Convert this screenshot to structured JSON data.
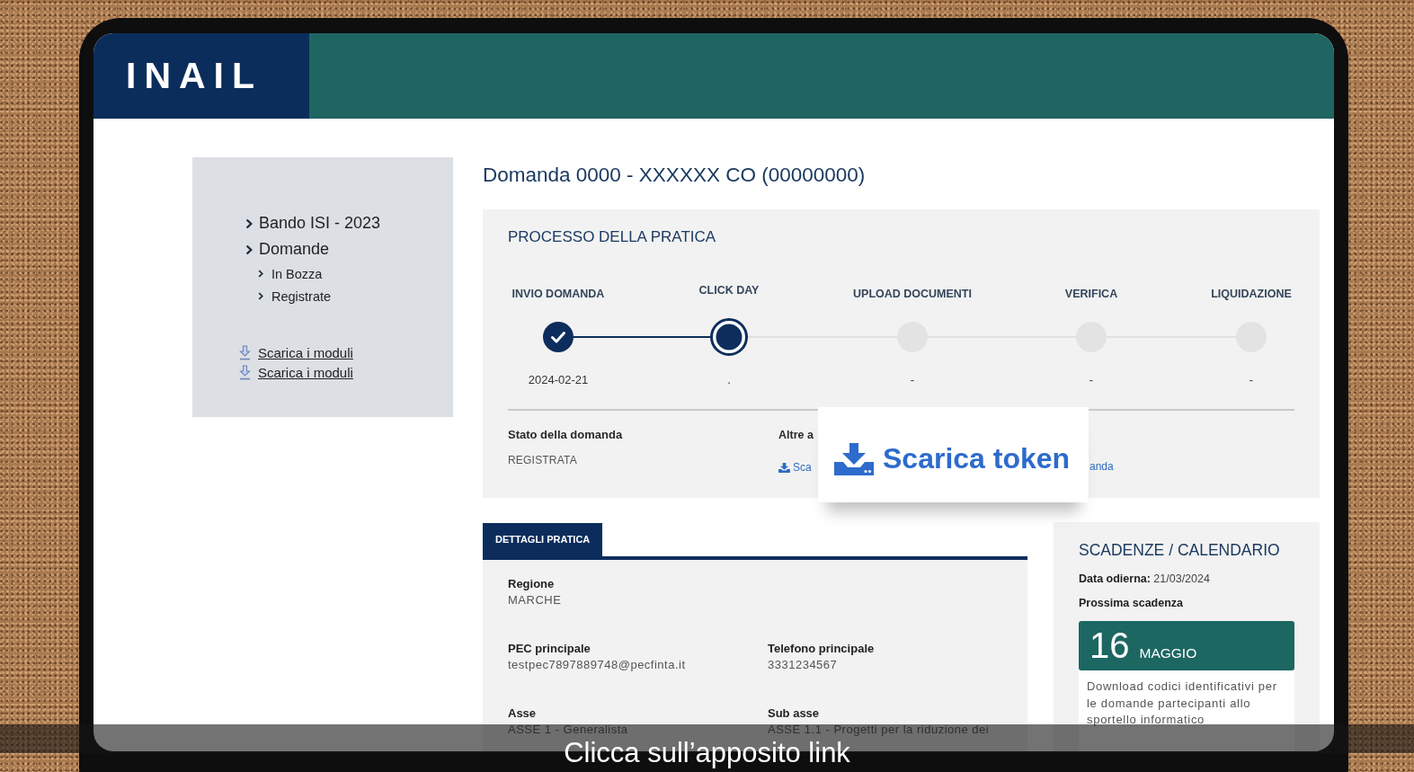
{
  "header": {
    "logo": "INAIL"
  },
  "sidebar": {
    "items": [
      {
        "label": "Bando ISI - 2023"
      },
      {
        "label": "Domande",
        "children": [
          {
            "label": "In Bozza"
          },
          {
            "label": "Registrate"
          }
        ]
      }
    ],
    "links": [
      "Scarica i moduli",
      "Scarica i moduli"
    ]
  },
  "title": "Domanda 0000 - XXXXXX CO (00000000)",
  "process": {
    "title": "PROCESSO DELLA PRATICA",
    "steps": [
      {
        "label": "INVIO DOMANDA",
        "done": true,
        "current": false,
        "date": "2024-02-21"
      },
      {
        "label": "CLICK DAY",
        "done": false,
        "current": true,
        "date": "."
      },
      {
        "label": "UPLOAD DOCUMENTI",
        "done": false,
        "current": false,
        "date": "-"
      },
      {
        "label": "VERIFICA",
        "done": false,
        "current": false,
        "date": "-"
      },
      {
        "label": "LIQUIDAZIONE",
        "done": false,
        "current": false,
        "date": "-"
      }
    ],
    "summary": {
      "status_label": "Stato della domanda",
      "status_value": "REGISTRATA",
      "actions_label": "Altre a",
      "action_link": "Sca",
      "link_3": "anda"
    }
  },
  "callout": {
    "label": "Scarica token"
  },
  "details": {
    "tab": "DETTAGLI PRATICA",
    "rows": [
      [
        {
          "label": "Regione",
          "value": "MARCHE"
        }
      ],
      [
        {
          "label": "PEC principale",
          "value": "testpec7897889748@pecfinta.it"
        },
        {
          "label": "Telefono principale",
          "value": "3331234567"
        }
      ],
      [
        {
          "label": "Asse",
          "value": "ASSE 1 - Generalista"
        },
        {
          "label": "Sub asse",
          "value": "ASSE 1.1 - Progetti per la riduzione dei"
        }
      ]
    ]
  },
  "calendar": {
    "title": "SCADENZE / CALENDARIO",
    "today": "**Data odierna:** 21/03/2024",
    "next_label": "Prossima scadenza",
    "day": "16",
    "month": "MAGGIO",
    "description": "Download codici identificativi per le domande partecipanti allo sportello informatico"
  },
  "caption": "Clicca sull’apposito link"
}
